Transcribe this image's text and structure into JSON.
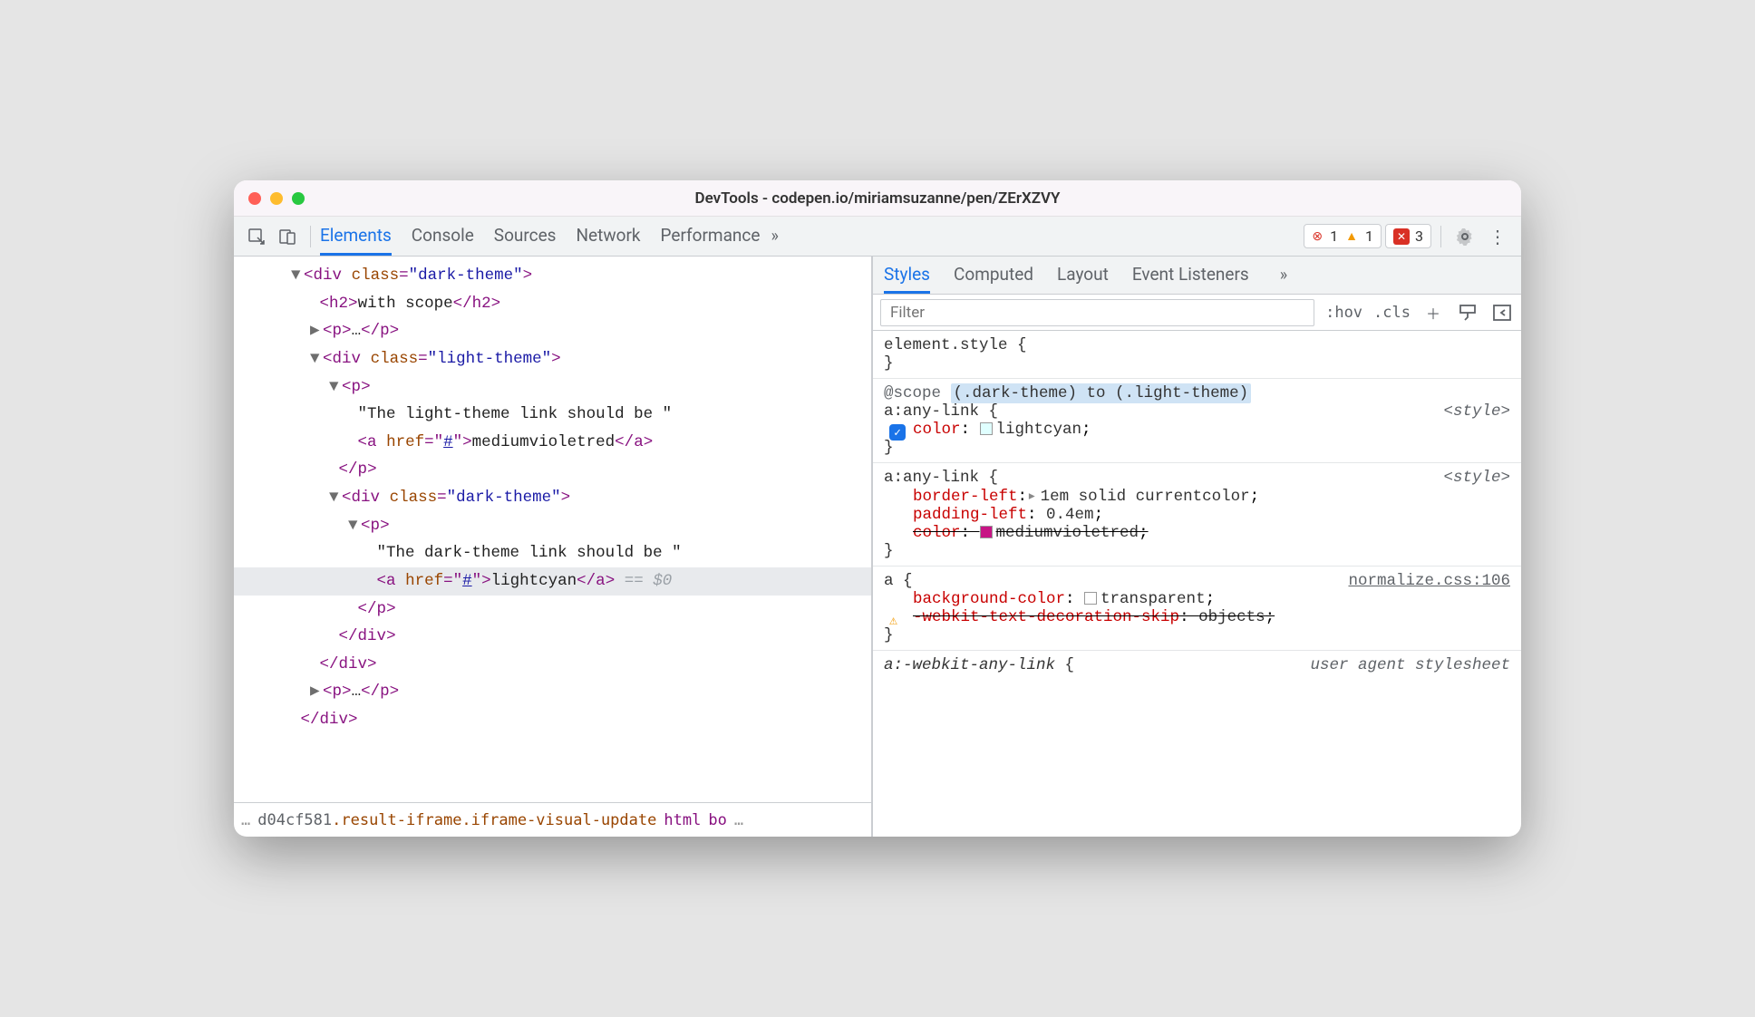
{
  "window": {
    "title": "DevTools - codepen.io/miriamsuzanne/pen/ZErXZVY"
  },
  "tabs": [
    "Elements",
    "Console",
    "Sources",
    "Network",
    "Performance"
  ],
  "badges": {
    "errors": "1",
    "warnings": "1",
    "issues": "3"
  },
  "dom": {
    "l1": "div",
    "l1_attr": "class",
    "l1_val": "\"dark-theme\"",
    "l2": "h2",
    "l2_txt": "with scope",
    "l3": "p",
    "l3_ell": "…",
    "l4": "div",
    "l4_attr": "class",
    "l4_val": "\"light-theme\"",
    "l5": "p",
    "l6_txt": "\"The light-theme link should be \"",
    "l7": "a",
    "l7_attr": "href",
    "l7_val": "#",
    "l7_txt": "mediumvioletred",
    "l8": "div",
    "l8_attr": "class",
    "l8_val": "\"dark-theme\"",
    "l9": "p",
    "l10_txt": "\"The dark-theme link should be \"",
    "l11": "a",
    "l11_attr": "href",
    "l11_val": "#",
    "l11_txt": "lightcyan",
    "l11_ref": "== $0",
    "lp": "p",
    "lp_ell": "…"
  },
  "breadcrumb": {
    "hash": "d04cf581",
    "rest": ".result-iframe.iframe-visual-update",
    "html": "html",
    "bo": "bo"
  },
  "subtabs": [
    "Styles",
    "Computed",
    "Layout",
    "Event Listeners"
  ],
  "styles_toolbar": {
    "filter_placeholder": "Filter",
    "hov": ":hov",
    "cls": ".cls"
  },
  "rules": {
    "r0_sel": "element.style",
    "r1_scope": "@scope",
    "r1_scope_hl": "(.dark-theme) to (.light-theme)",
    "r1_sel": "a:any-link",
    "r1_src": "<style>",
    "r1_p1": "color",
    "r1_v1": "lightcyan",
    "r2_sel": "a:any-link",
    "r2_src": "<style>",
    "r2_p1": "border-left",
    "r2_v1": "1em solid currentcolor",
    "r2_p2": "padding-left",
    "r2_v2": "0.4em",
    "r2_p3": "color",
    "r2_v3": "mediumvioletred",
    "r3_sel": "a",
    "r3_src": "normalize.css:106",
    "r3_p1": "background-color",
    "r3_v1": "transparent",
    "r3_p2": "-webkit-text-decoration-skip",
    "r3_v2": "objects",
    "r4_sel": "a:-webkit-any-link",
    "r4_src": "user agent stylesheet"
  }
}
